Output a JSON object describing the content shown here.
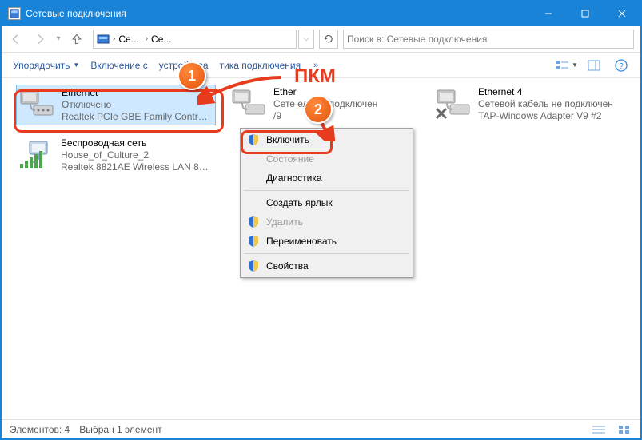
{
  "window": {
    "title": "Сетевые подключения"
  },
  "breadcrumb": {
    "seg1": "Се...",
    "seg2": "Се..."
  },
  "search": {
    "placeholder": "Поиск в: Сетевые подключения"
  },
  "toolbar": {
    "organize": "Упорядочить",
    "enable": "Включение с",
    "device": "устройства",
    "diagnose": "тика подключения",
    "overflow": "»"
  },
  "connections": {
    "c1": {
      "name": "Ethernet",
      "status": "Отключено",
      "device": "Realtek PCIe GBE Family Controll..."
    },
    "c2": {
      "name": "Ether",
      "status": "Сете            ель не подключен",
      "device": "/9"
    },
    "c3": {
      "name": "Ethernet 4",
      "status": "Сетевой кабель не подключен",
      "device": "TAP-Windows Adapter V9 #2"
    },
    "c4": {
      "name": "Беспроводная сеть",
      "status": "House_of_Culture_2",
      "device": "Realtek 8821AE Wireless LAN 802...."
    }
  },
  "context_menu": {
    "enable": "Включить",
    "status": "Состояние",
    "diagnose": "Диагностика",
    "shortcut": "Создать ярлык",
    "delete": "Удалить",
    "rename": "Переименовать",
    "properties": "Свойства"
  },
  "statusbar": {
    "elements": "Элементов: 4",
    "selected": "Выбран 1 элемент"
  },
  "annotations": {
    "pkm": "ПКМ",
    "c1": "1",
    "c2": "2"
  }
}
